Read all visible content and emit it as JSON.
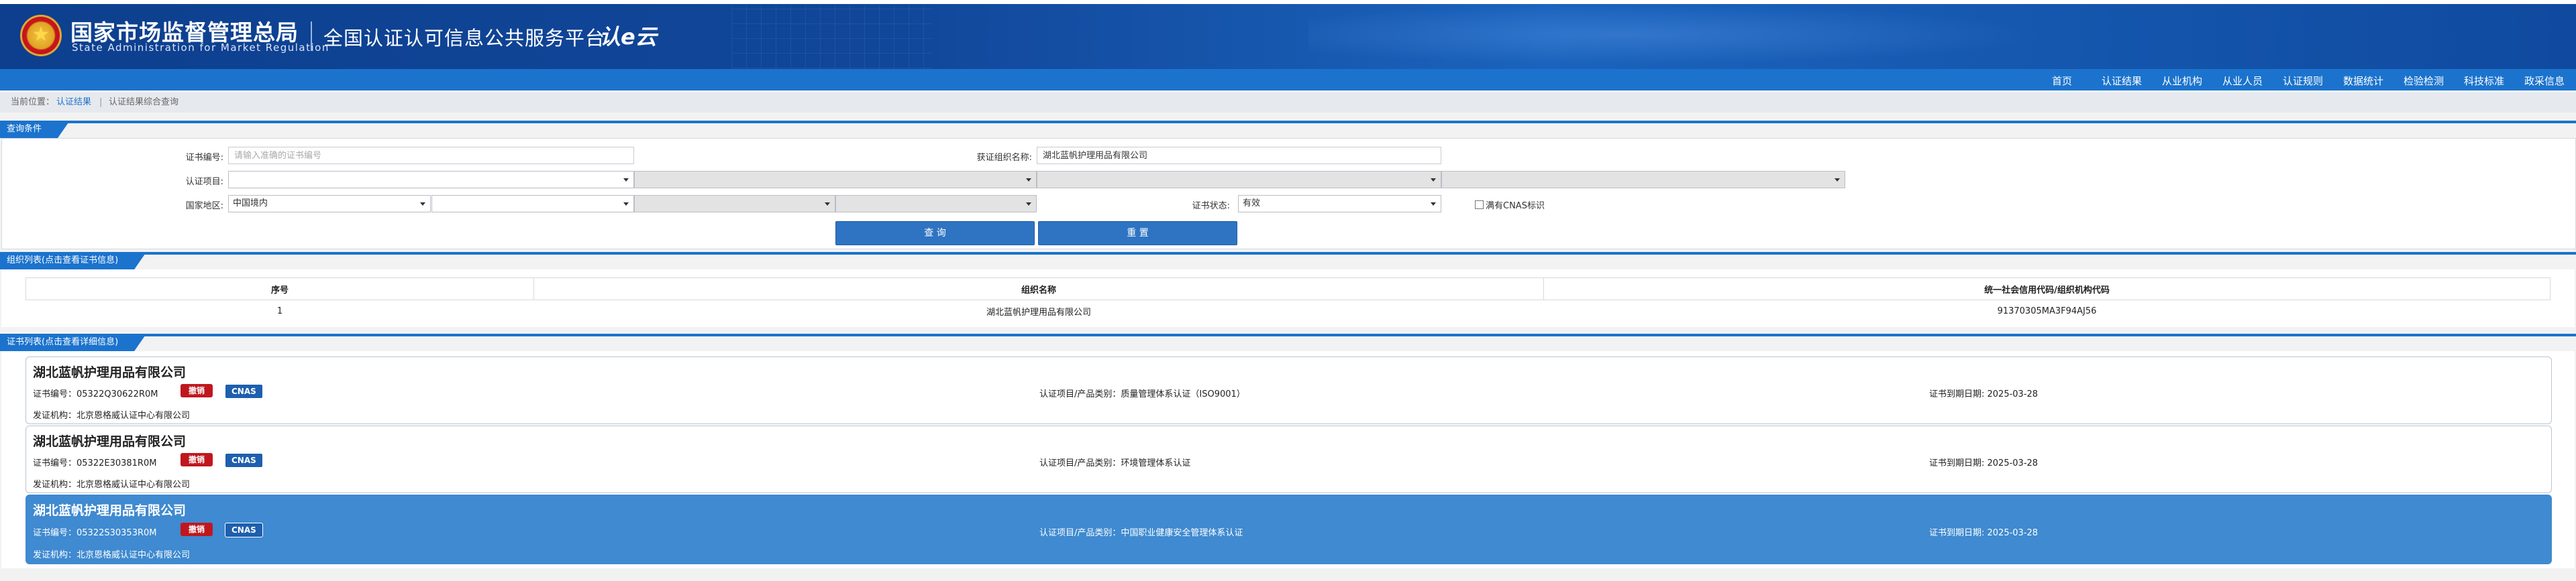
{
  "header": {
    "org_cn": "国家市场监督管理总局",
    "org_en": "State Administration  for  Market Regulation",
    "platform": "全国认证认可信息公共服务平台",
    "logo_mark": "认e云"
  },
  "nav": [
    "首页",
    "认证结果",
    "从业机构",
    "从业人员",
    "认证规则",
    "数据统计",
    "检验检测",
    "科技标准",
    "政采信息"
  ],
  "breadcrumb": {
    "prefix": "当前位置：",
    "link": "认证结果",
    "sep": "|",
    "current": "认证结果综合查询"
  },
  "query": {
    "section_label": "查询条件",
    "cert_no_label": "证书编号:",
    "cert_no_placeholder": "请输入准确的证书编号",
    "org_name_label": "获证组织名称:",
    "org_name_value": "湖北蓝帆护理用品有限公司",
    "project_label": "认证项目:",
    "region_label": "国家地区:",
    "region_value": "中国境内",
    "status_label": "证书状态:",
    "status_value": "有效",
    "cnas_label": "满有CNAS标识",
    "search_btn": "查 询",
    "reset_btn": "重 置"
  },
  "org_list": {
    "section_label": "组织列表(点击查看证书信息)",
    "columns": [
      "序号",
      "组织名称",
      "统一社会信用代码/组织机构代码"
    ],
    "rows": [
      {
        "no": "1",
        "name": "湖北蓝帆护理用品有限公司",
        "code": "91370305MA3F94AJ56"
      }
    ]
  },
  "cert_list": {
    "section_label": "证书列表(点击查看详细信息)",
    "items": [
      {
        "org": "湖北蓝帆护理用品有限公司",
        "cert_no": "证书编号：05322Q30622R0M",
        "status_tag": "撤销",
        "cnas_tag": "CNAS",
        "project": "认证项目/产品类别：质量管理体系认证（ISO9001）",
        "expire": "证书到期日期: 2025-03-28",
        "issuer": "发证机构：北京恩格威认证中心有限公司"
      },
      {
        "org": "湖北蓝帆护理用品有限公司",
        "cert_no": "证书编号：05322E30381R0M",
        "status_tag": "撤销",
        "cnas_tag": "CNAS",
        "project": "认证项目/产品类别：环境管理体系认证",
        "expire": "证书到期日期: 2025-03-28",
        "issuer": "发证机构：北京恩格威认证中心有限公司"
      },
      {
        "org": "湖北蓝帆护理用品有限公司",
        "cert_no": "证书编号：05322S30353R0M",
        "status_tag": "撤销",
        "cnas_tag": "CNAS",
        "project": "认证项目/产品类别：中国职业健康安全管理体系认证",
        "expire": "证书到期日期: 2025-03-28",
        "issuer": "发证机构：北京恩格威认证中心有限公司"
      }
    ]
  },
  "colors": {
    "header": "#0d3f8e",
    "nav": "#1b73cd",
    "button": "#2e74c2",
    "revoked_tag": "#c0171f",
    "cnas_tag": "#1e5fae",
    "active_card": "#3f8ad0"
  }
}
